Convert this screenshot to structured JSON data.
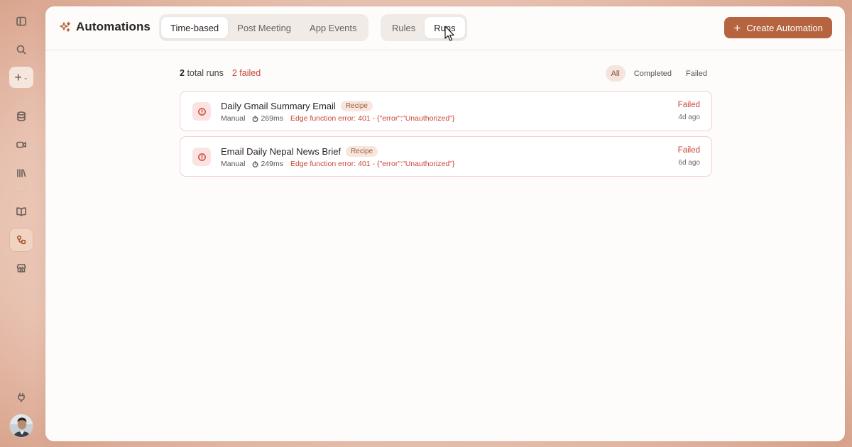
{
  "app": {
    "title": "Automations"
  },
  "tabs": {
    "type_tabs": [
      {
        "label": "Time-based",
        "active": true
      },
      {
        "label": "Post Meeting",
        "active": false
      },
      {
        "label": "App Events",
        "active": false
      }
    ],
    "view_tabs": [
      {
        "label": "Rules",
        "active": false
      },
      {
        "label": "Runs",
        "active": true
      }
    ]
  },
  "actions": {
    "create_label": "Create Automation"
  },
  "summary": {
    "total_count": "2",
    "total_label": "total runs",
    "failed_label": "2 failed"
  },
  "filters": [
    {
      "label": "All",
      "active": true
    },
    {
      "label": "Completed",
      "active": false
    },
    {
      "label": "Failed",
      "active": false
    }
  ],
  "runs": [
    {
      "title": "Daily Gmail Summary Email",
      "badge": "Recipe",
      "trigger": "Manual",
      "duration": "269ms",
      "error": "Edge function error: 401 - {\"error\":\"Unauthorized\"}",
      "status": "Failed",
      "time": "4d ago"
    },
    {
      "title": "Email Daily Nepal News Brief",
      "badge": "Recipe",
      "trigger": "Manual",
      "duration": "249ms",
      "error": "Edge function error: 401 - {\"error\":\"Unauthorized\"}",
      "status": "Failed",
      "time": "6d ago"
    }
  ],
  "sidebar": {
    "icons": [
      "panel-toggle-icon",
      "search-icon",
      "plus-icon",
      "database-icon",
      "video-icon",
      "library-icon",
      "book-icon",
      "automations-icon",
      "store-icon",
      "plug-icon"
    ],
    "active": "automations-icon"
  },
  "colors": {
    "accent": "#b5643f",
    "error": "#c9473a",
    "badge_bg": "#f7e6dd"
  }
}
